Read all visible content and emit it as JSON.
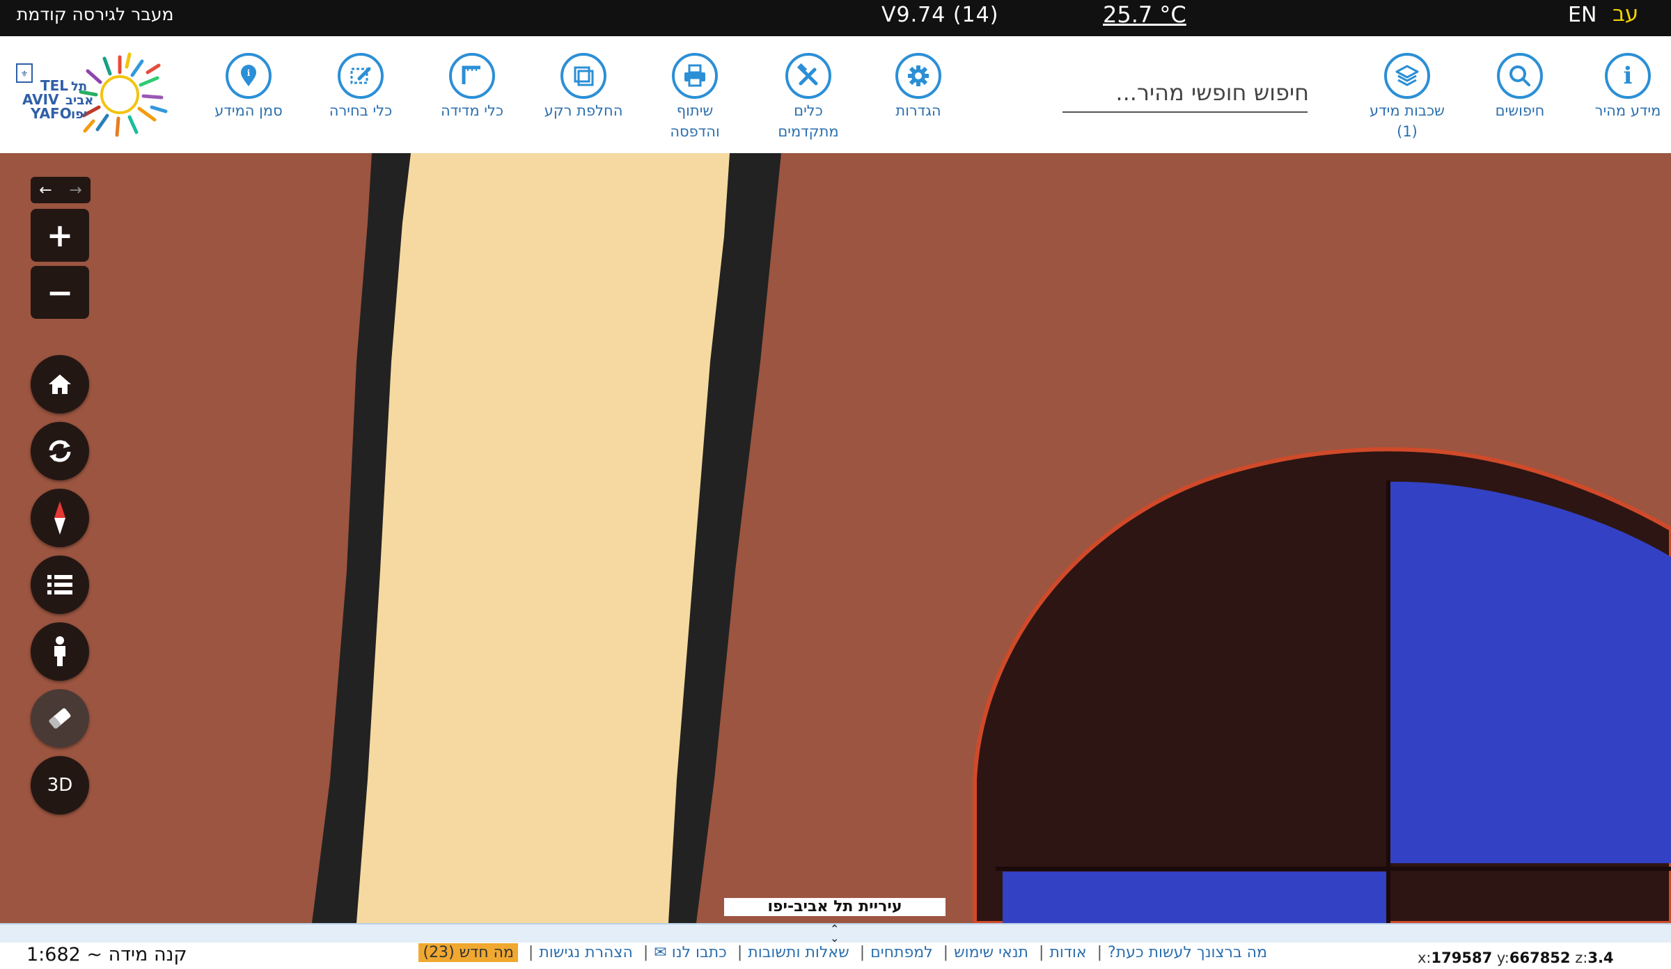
{
  "topbar": {
    "prev_version": "מעבר לגירסה קודמת",
    "version": "V9.74 (14)",
    "temperature": "25.7 °C",
    "lang_en": "EN",
    "lang_he": "עב"
  },
  "toolbar": {
    "items": [
      {
        "label": "מידע מהיר",
        "icon": "info-icon"
      },
      {
        "label": "חיפושים",
        "icon": "search-icon"
      },
      {
        "label": "שכבות מידע\n(1)",
        "icon": "layers-icon"
      },
      {
        "label": "הגדרות",
        "icon": "gear-icon"
      },
      {
        "label": "כלים\nמתקדמים",
        "icon": "tools-icon"
      },
      {
        "label": "שיתוף\nוהדפסה",
        "icon": "printer-icon"
      },
      {
        "label": "החלפת רקע",
        "icon": "background-icon"
      },
      {
        "label": "כלי מדידה",
        "icon": "ruler-icon"
      },
      {
        "label": "כלי בחירה",
        "icon": "selection-icon"
      },
      {
        "label": "סמן המידע",
        "icon": "pin-icon"
      }
    ],
    "search_placeholder": "חיפוש חופשי מהיר..."
  },
  "logo": {
    "text_en": "TEL AVIV YAFO",
    "text_he": "תל אביב יפו"
  },
  "map_controls": {
    "zoom_in": "+",
    "zoom_out": "−",
    "three_d": "3D"
  },
  "map": {
    "credit": "עיריית תל אביב-יפו"
  },
  "bottom": {
    "scale": "קנה מידה ~ 1:682",
    "links": [
      "מה ברצונך לעשות כעת?",
      "אודות",
      "תנאי שימוש",
      "למפתחים",
      "שאלות ותשובות",
      "כתבו לנו ✉",
      "הצהרת נגישות"
    ],
    "whats_new": "מה חדש (23)",
    "coords": {
      "x_label": "x:",
      "x": "179587",
      "y_label": "y:",
      "y": "667852",
      "z_label": "z:",
      "z": "3.4"
    }
  },
  "colors": {
    "accent": "#2b8fd6",
    "map_background": "#9c5540",
    "road": "#f5d9a0",
    "road_edge": "#222222",
    "building": "#2d1513",
    "blue_area": "#3341c4"
  }
}
